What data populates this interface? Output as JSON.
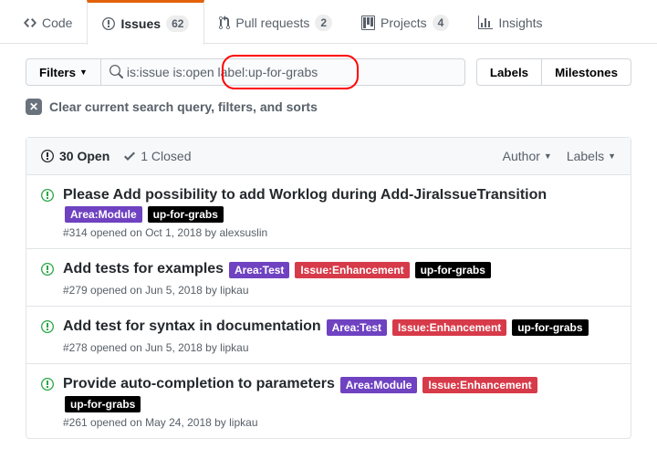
{
  "tabs": {
    "code": "Code",
    "issues": "Issues",
    "issues_count": "62",
    "pulls": "Pull requests",
    "pulls_count": "2",
    "projects": "Projects",
    "projects_count": "4",
    "insights": "Insights"
  },
  "toolbar": {
    "filters_label": "Filters",
    "search_value": "is:issue is:open label:up-for-grabs",
    "labels_btn": "Labels",
    "milestones_btn": "Milestones"
  },
  "clear_text": "Clear current search query, filters, and sorts",
  "list_header": {
    "open_text": "30 Open",
    "closed_text": "1 Closed",
    "author": "Author",
    "labels": "Labels"
  },
  "label_colors": {
    "Area:Module": "#6f42c1",
    "Area:Test": "#6f42c1",
    "Issue:Enhancement": "#d73a49",
    "up-for-grabs": "#000000"
  },
  "issues": [
    {
      "title": "Please Add possibility to add Worklog during Add-JiraIssueTransition",
      "labels": [
        "Area:Module",
        "up-for-grabs"
      ],
      "meta": "#314 opened on Oct 1, 2018 by alexsuslin"
    },
    {
      "title": "Add tests for examples",
      "labels": [
        "Area:Test",
        "Issue:Enhancement",
        "up-for-grabs"
      ],
      "meta": "#279 opened on Jun 5, 2018 by lipkau"
    },
    {
      "title": "Add test for syntax in documentation",
      "labels": [
        "Area:Test",
        "Issue:Enhancement",
        "up-for-grabs"
      ],
      "meta": "#278 opened on Jun 5, 2018 by lipkau"
    },
    {
      "title": "Provide auto-completion to parameters",
      "labels": [
        "Area:Module",
        "Issue:Enhancement",
        "up-for-grabs"
      ],
      "meta": "#261 opened on May 24, 2018 by lipkau"
    }
  ]
}
